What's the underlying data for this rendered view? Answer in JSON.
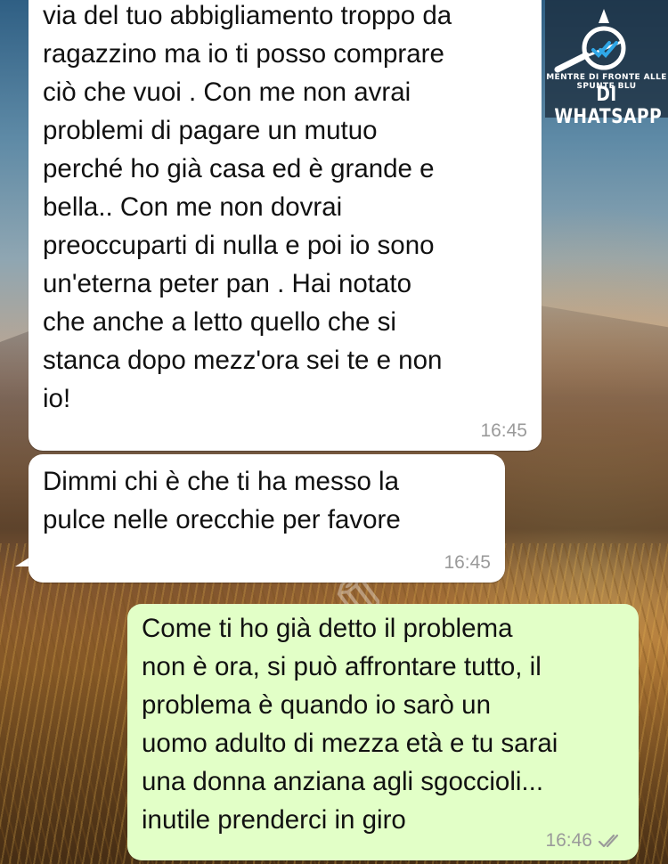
{
  "logo": {
    "tagline": "MENTRE DI FRONTE ALLE SPUNTE BLU",
    "title": "DI WHATSAPP"
  },
  "messages": [
    {
      "direction": "incoming",
      "text": "via del tuo abbigliamento troppo da\nragazzino ma io ti posso comprare\nciò che vuoi . Con me non avrai\nproblemi di pagare un mutuo\nperché ho già casa ed è grande e\nbella.. Con me non dovrai\npreoccuparti di nulla e poi io sono\nun'eterna peter pan .  Hai notato\nche anche a letto quello che si\nstanca dopo mezz'ora sei te e non\nio!",
      "time": "16:45"
    },
    {
      "direction": "incoming",
      "text": "Dimmi chi è che ti ha messo la\npulce nelle orecchie per favore",
      "time": "16:45"
    },
    {
      "direction": "outgoing",
      "text": "Come ti ho già detto il problema\nnon è ora, si può affrontare tutto, il\nproblema è quando io sarò un\nuomo adulto di mezza età e tu sarai\nuna donna anziana agli sgoccioli...\ninutile prenderci in giro",
      "time": "16:46",
      "status_icon": "double-check-icon"
    }
  ],
  "colors": {
    "incoming_bubble": "#ffffff",
    "outgoing_bubble": "#e2ffc7",
    "timestamp": "#9a9a9a"
  }
}
